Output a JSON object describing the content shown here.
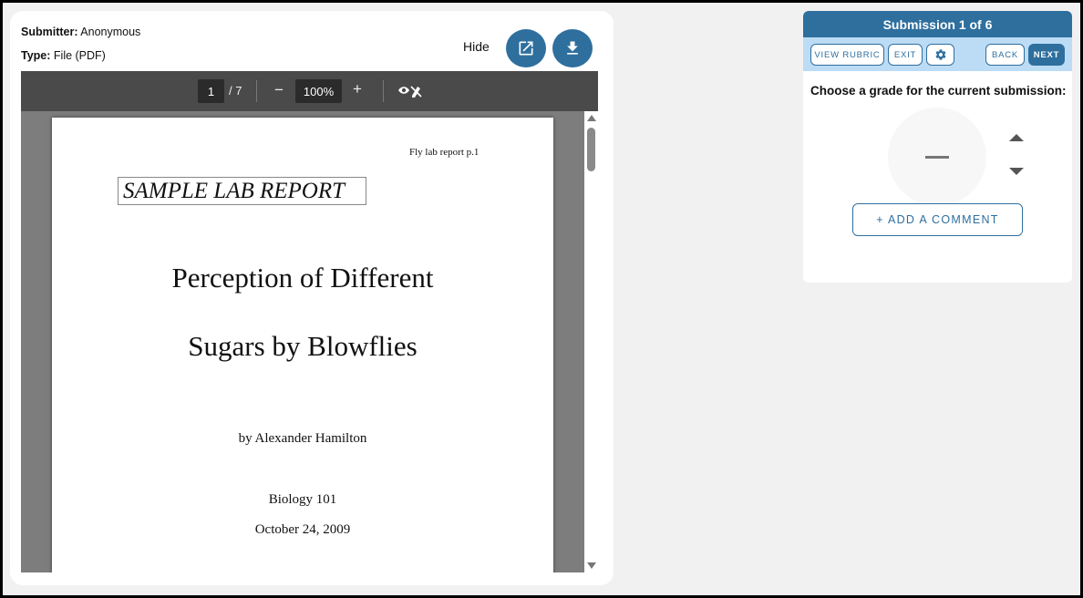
{
  "submission": {
    "submitter_label": "Submitter:",
    "submitter_value": "Anonymous",
    "type_label": "Type:",
    "type_value": "File (PDF)",
    "hide_label": "Hide"
  },
  "viewer": {
    "current_page": "1",
    "total_pages": "/ 7",
    "zoom_minus": "−",
    "zoom": "100%",
    "zoom_plus": "+"
  },
  "document": {
    "header_note": "Fly lab report p.1",
    "sample_label": "SAMPLE LAB REPORT",
    "title_line1": "Perception of Different",
    "title_line2": "Sugars by Blowflies",
    "author": "by Alexander Hamilton",
    "course": "Biology 101",
    "date": "October 24, 2009"
  },
  "grading": {
    "title": "Submission 1 of 6",
    "view_rubric": "VIEW RUBRIC",
    "exit": "EXIT",
    "back": "BACK",
    "next": "NEXT",
    "prompt": "Choose a grade for the current submission:",
    "add_comment": "+ ADD A COMMENT"
  },
  "icons": {
    "open": "open-in-new-icon",
    "download": "download-icon",
    "annotation": "eye-edit-icon",
    "settings": "gear-icon"
  },
  "colors": {
    "accent": "#2e6f9e",
    "bar": "#bcdcf5",
    "toolbar": "#4a4a4a"
  }
}
